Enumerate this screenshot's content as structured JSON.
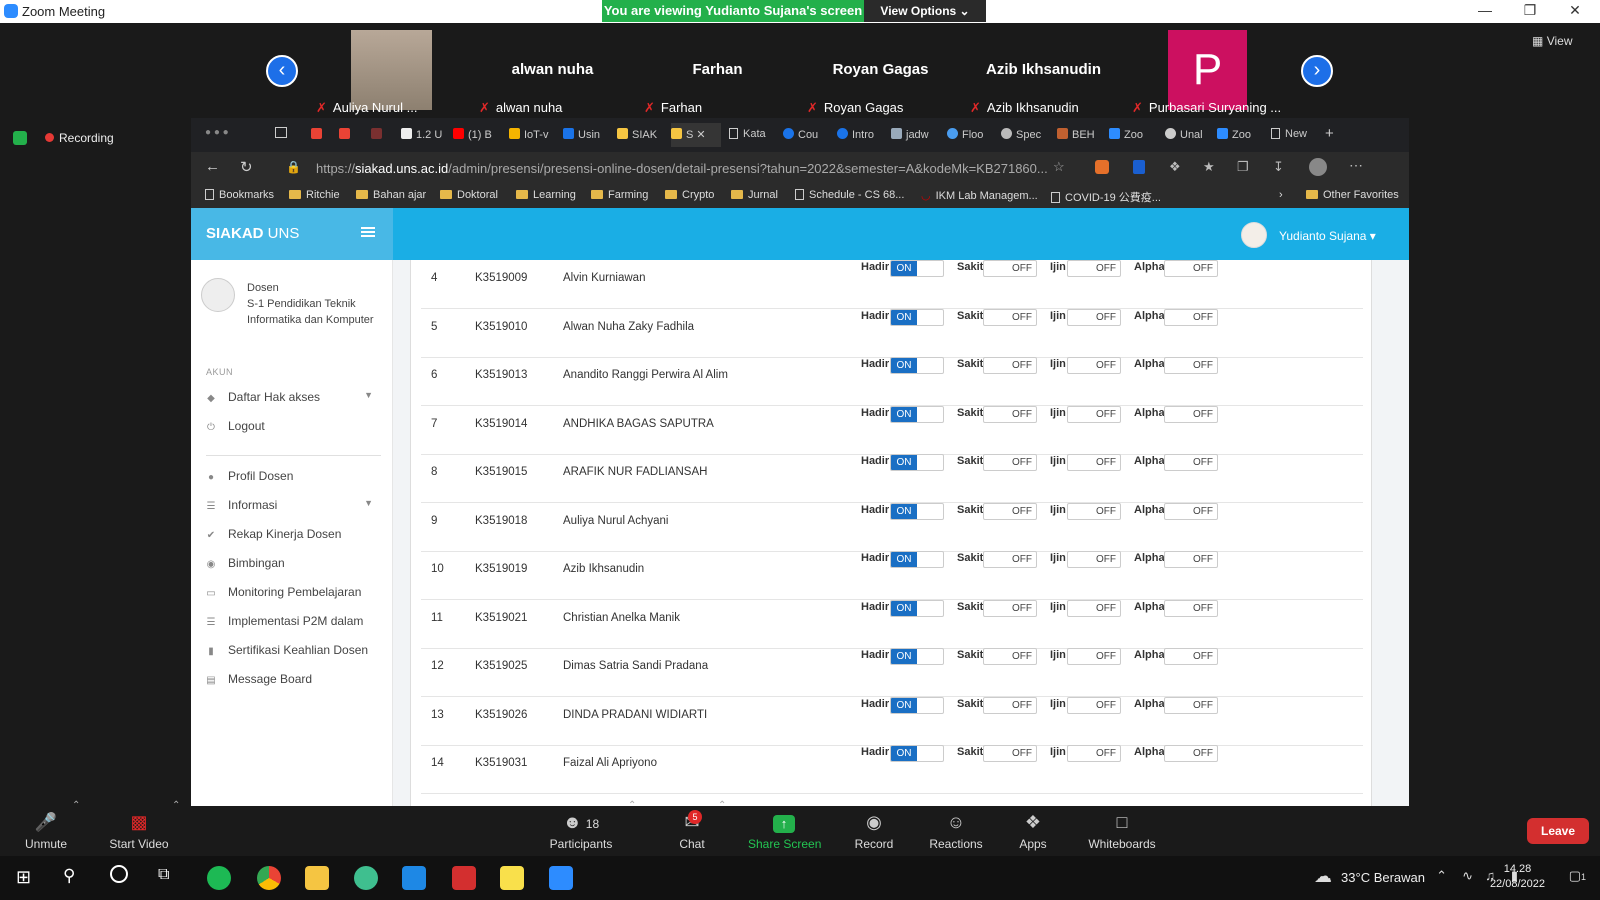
{
  "zoom": {
    "window_title": "Zoom Meeting",
    "banner_text": "You are viewing Yudianto Sujana's screen",
    "view_options_label": "View Options",
    "view_label": "View",
    "recording_label": "Recording",
    "participants": [
      {
        "big_name": "",
        "label": "Auliya Nurul ..."
      },
      {
        "big_name": "alwan nuha",
        "label": "alwan nuha"
      },
      {
        "big_name": "Farhan",
        "label": "Farhan"
      },
      {
        "big_name": "Royan Gagas",
        "label": "Royan Gagas"
      },
      {
        "big_name": "Azib Ikhsanudin",
        "label": "Azib Ikhsanudin"
      },
      {
        "big_name": "P",
        "label": "Purbasari Suryaning ..."
      }
    ],
    "toolbar": {
      "unmute": "Unmute",
      "start_video": "Start Video",
      "participants": "Participants",
      "participants_count": "18",
      "chat": "Chat",
      "chat_badge": "5",
      "share_screen": "Share Screen",
      "record": "Record",
      "reactions": "Reactions",
      "apps": "Apps",
      "whiteboards": "Whiteboards",
      "leave": "Leave"
    }
  },
  "browser": {
    "tabs": [
      "1.2 U",
      "(1) B",
      "IoT-v",
      "Usin",
      "SIAK",
      "S",
      "Kata",
      "Cou",
      "Intro",
      "jadw",
      "Floo",
      "Spec",
      "BEH",
      "Zoo",
      "Unal",
      "Zoo",
      "New"
    ],
    "url_prefix": "https://",
    "url_domain": "siakad.uns.ac.id",
    "url_rest": "/admin/presensi/presensi-online-dosen/detail-presensi?tahun=2022&semester=A&kodeMk=KB271860...",
    "bookmarks": [
      "Bookmarks",
      "Ritchie",
      "Bahan ajar",
      "Doktoral",
      "Learning",
      "Farming",
      "Crypto",
      "Jurnal",
      "Schedule - CS 68...",
      "IKM Lab Managem...",
      "COVID-19 公費疫...",
      "Other Favorites"
    ]
  },
  "app": {
    "brand_bold": "SIAKAD",
    "brand_rest": " UNS",
    "user_name": "Yudianto Sujana",
    "role_title": "Dosen",
    "role_desc": "S-1 Pendidikan Teknik Informatika dan Komputer",
    "section_akun": "AKUN",
    "menu_akun": [
      "Daftar Hak akses",
      "Logout"
    ],
    "menu_main": [
      "Profil Dosen",
      "Informasi",
      "Rekap Kinerja Dosen",
      "Bimbingan",
      "Monitoring Pembelajaran",
      "Implementasi P2M dalam",
      "Sertifikasi Keahlian Dosen",
      "Message Board"
    ],
    "att_labels": {
      "hadir": "Hadir",
      "sakit": "Sakit",
      "ijin": "Ijin",
      "alpha": "Alpha",
      "on": "ON",
      "off": "OFF"
    },
    "students": [
      {
        "no": "4",
        "nim": "K3519009",
        "nama": "Alvin Kurniawan"
      },
      {
        "no": "5",
        "nim": "K3519010",
        "nama": "Alwan Nuha Zaky Fadhila"
      },
      {
        "no": "6",
        "nim": "K3519013",
        "nama": "Anandito Ranggi Perwira Al Alim"
      },
      {
        "no": "7",
        "nim": "K3519014",
        "nama": "ANDHIKA BAGAS SAPUTRA"
      },
      {
        "no": "8",
        "nim": "K3519015",
        "nama": "ARAFIK NUR FADLIANSAH"
      },
      {
        "no": "9",
        "nim": "K3519018",
        "nama": "Auliya Nurul Achyani"
      },
      {
        "no": "10",
        "nim": "K3519019",
        "nama": "Azib Ikhsanudin"
      },
      {
        "no": "11",
        "nim": "K3519021",
        "nama": "Christian Anelka Manik"
      },
      {
        "no": "12",
        "nim": "K3519025",
        "nama": "Dimas Satria Sandi Pradana"
      },
      {
        "no": "13",
        "nim": "K3519026",
        "nama": "DINDA PRADANI WIDIARTI"
      },
      {
        "no": "14",
        "nim": "K3519031",
        "nama": "Faizal Ali Apriyono"
      }
    ]
  },
  "taskbar": {
    "weather": "33°C  Berawan",
    "time": "14.28",
    "date": "22/08/2022",
    "notif_count": "1"
  }
}
